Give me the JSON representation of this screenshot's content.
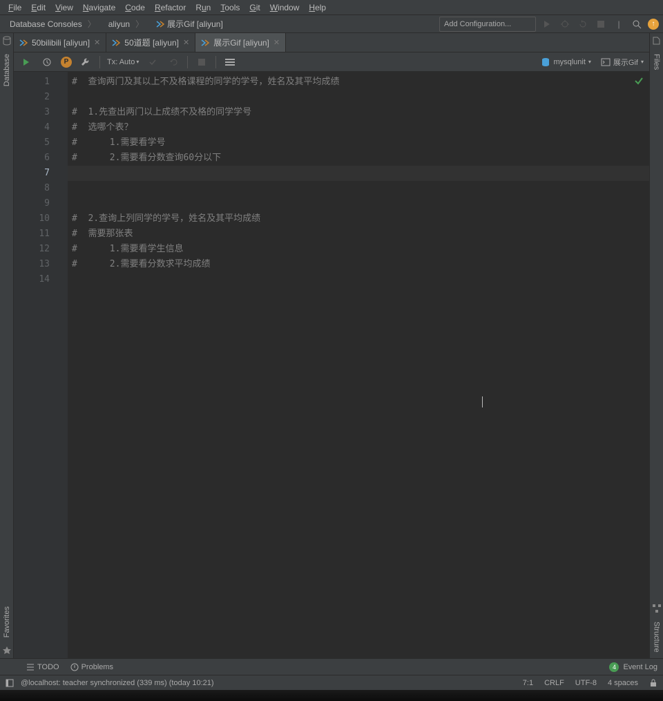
{
  "menus": [
    "File",
    "Edit",
    "View",
    "Navigate",
    "Code",
    "Refactor",
    "Run",
    "Tools",
    "Git",
    "Window",
    "Help"
  ],
  "breadcrumb": [
    "Database Consoles",
    "aliyun",
    "展示Gif [aliyun]"
  ],
  "addConfig": "Add Configuration...",
  "tabs": [
    {
      "label": "50bilibili [aliyun]",
      "active": false
    },
    {
      "label": "50道题 [aliyun]",
      "active": false
    },
    {
      "label": "展示Gif [aliyun]",
      "active": true
    }
  ],
  "toolbar": {
    "tx": "Tx: Auto",
    "right": [
      {
        "icon": "db",
        "label": "mysqlunit"
      },
      {
        "icon": "console",
        "label": "展示Gif"
      }
    ]
  },
  "leftRail": {
    "database": "Database",
    "favorites": "Favorites"
  },
  "rightRail": {
    "files": "Files",
    "structure": "Structure"
  },
  "code": {
    "lines": [
      "#  查询两门及其以上不及格课程的同学的学号，姓名及其平均成绩",
      "",
      "#  1.先查出两门以上成绩不及格的同学学号",
      "#  选哪个表？",
      "#      1.需要看学号",
      "#      2.需要看分数查询60分以下",
      "",
      "",
      "",
      "#  2.查询上列同学的学号，姓名及其平均成绩",
      "#  需要那张表",
      "#      1.需要看学生信息",
      "#      2.需要看分数求平均成绩",
      ""
    ],
    "currentLine": 7
  },
  "bottom": {
    "todo": "TODO",
    "problems": "Problems",
    "eventLog": "Event Log",
    "count": "4"
  },
  "status": {
    "msg": "@localhost: teacher synchronized (339 ms) (today 10:21)",
    "pos": "7:1",
    "eol": "CRLF",
    "enc": "UTF-8",
    "indent": "4 spaces"
  }
}
